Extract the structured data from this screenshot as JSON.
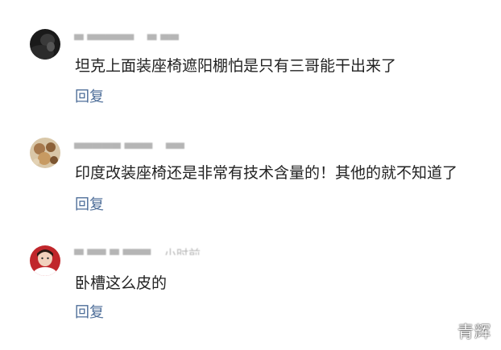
{
  "comments": [
    {
      "user": "▇ ▇▇▇▇▇",
      "time": "▇ ▇▇",
      "text": "坦克上面装座椅遮阳棚怕是只有三哥能干出来了",
      "reply_label": "回复",
      "avatar": "dark-avatar"
    },
    {
      "user": "▇▇▇▇▇ ▇▇▇",
      "time": "▇▇",
      "text": "印度改装座椅还是非常有技术含量的！其他的就不知道了",
      "reply_label": "回复",
      "avatar": "food-avatar"
    },
    {
      "user": "▇ ▇▇ ▇ ▇▇▇",
      "time": "小时前",
      "text": "卧槽这么皮的",
      "reply_label": "回复",
      "avatar": "red-avatar"
    }
  ],
  "watermark": "青辉"
}
